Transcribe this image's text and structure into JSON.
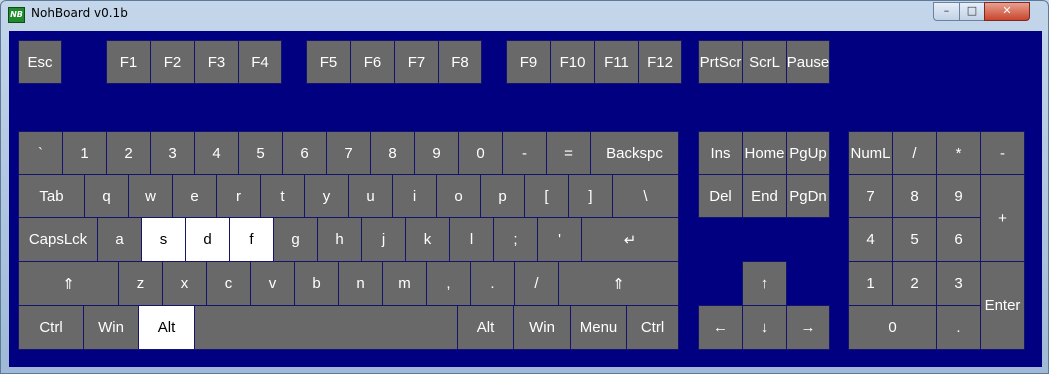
{
  "window": {
    "title": "NohBoard v0.1b",
    "icon_text": "NB",
    "controls": {
      "minimize": "–",
      "maximize": "□",
      "close": "✕"
    }
  },
  "colors": {
    "background": "#000080",
    "key": "#696969",
    "key_pressed": "#ffffff",
    "key_text": "#ffffff"
  },
  "pressed_keys": [
    "s",
    "d",
    "f",
    "alt-left"
  ],
  "keys": {
    "esc": "Esc",
    "f1": "F1",
    "f2": "F2",
    "f3": "F3",
    "f4": "F4",
    "f5": "F5",
    "f6": "F6",
    "f7": "F7",
    "f8": "F8",
    "f9": "F9",
    "f10": "F10",
    "f11": "F11",
    "f12": "F12",
    "prtscr": "PrtScr",
    "scrl": "ScrL",
    "pause": "Pause",
    "backtick": "`",
    "n1": "1",
    "n2": "2",
    "n3": "3",
    "n4": "4",
    "n5": "5",
    "n6": "6",
    "n7": "7",
    "n8": "8",
    "n9": "9",
    "n0": "0",
    "minus": "-",
    "equals": "=",
    "backspace": "Backspc",
    "tab": "Tab",
    "q": "q",
    "w": "w",
    "e": "e",
    "r": "r",
    "t": "t",
    "y": "y",
    "u": "u",
    "i": "i",
    "o": "o",
    "p": "p",
    "lbracket": "[",
    "rbracket": "]",
    "backslash": "\\",
    "capslock": "CapsLck",
    "a": "a",
    "s": "s",
    "d": "d",
    "f": "f",
    "g": "g",
    "h": "h",
    "j": "j",
    "k": "k",
    "l": "l",
    "semicolon": ";",
    "quote": "'",
    "enter": "↵",
    "lshift": "⇑",
    "z": "z",
    "x": "x",
    "c": "c",
    "v": "v",
    "b": "b",
    "n": "n",
    "m": "m",
    "comma": ",",
    "period": ".",
    "slash": "/",
    "rshift": "⇑",
    "lctrl": "Ctrl",
    "lwin": "Win",
    "lalt": "Alt",
    "space": "",
    "ralt": "Alt",
    "rwin": "Win",
    "menu": "Menu",
    "rctrl": "Ctrl",
    "ins": "Ins",
    "home": "Home",
    "pgup": "PgUp",
    "del": "Del",
    "end": "End",
    "pgdn": "PgDn",
    "up": "↑",
    "left": "←",
    "down": "↓",
    "right": "→",
    "numlock": "NumL",
    "numdiv": "/",
    "nummul": "*",
    "numsub": "-",
    "num7": "7",
    "num8": "8",
    "num9": "9",
    "numadd": "+",
    "num4": "4",
    "num5": "5",
    "num6": "6",
    "num1": "1",
    "num2": "2",
    "num3": "3",
    "numenter": "Enter",
    "num0": "0",
    "numdot": "."
  }
}
